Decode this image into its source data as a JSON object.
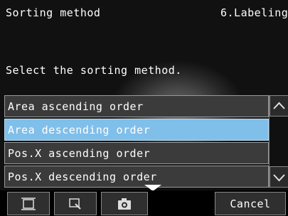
{
  "header": {
    "title": "Sorting method",
    "section": "6.Labeling"
  },
  "prompt": "Select the sorting method.",
  "list": {
    "items": [
      {
        "label": "Area ascending order"
      },
      {
        "label": "Area descending order"
      },
      {
        "label": "Pos.X ascending order"
      },
      {
        "label": "Pos.X descending order"
      }
    ],
    "selected_index": 1
  },
  "scrollbar": {
    "up_icon": "chevron-up-icon",
    "down_icon": "chevron-down-icon"
  },
  "toolbar": {
    "buttons": [
      {
        "icon": "fit-window-icon"
      },
      {
        "icon": "zoom-icon"
      },
      {
        "icon": "camera-icon"
      }
    ],
    "cancel_label": "Cancel"
  },
  "colors": {
    "selected_item": "#7fbfea",
    "item_background": "#3b3b3b",
    "text": "#ffffff"
  }
}
